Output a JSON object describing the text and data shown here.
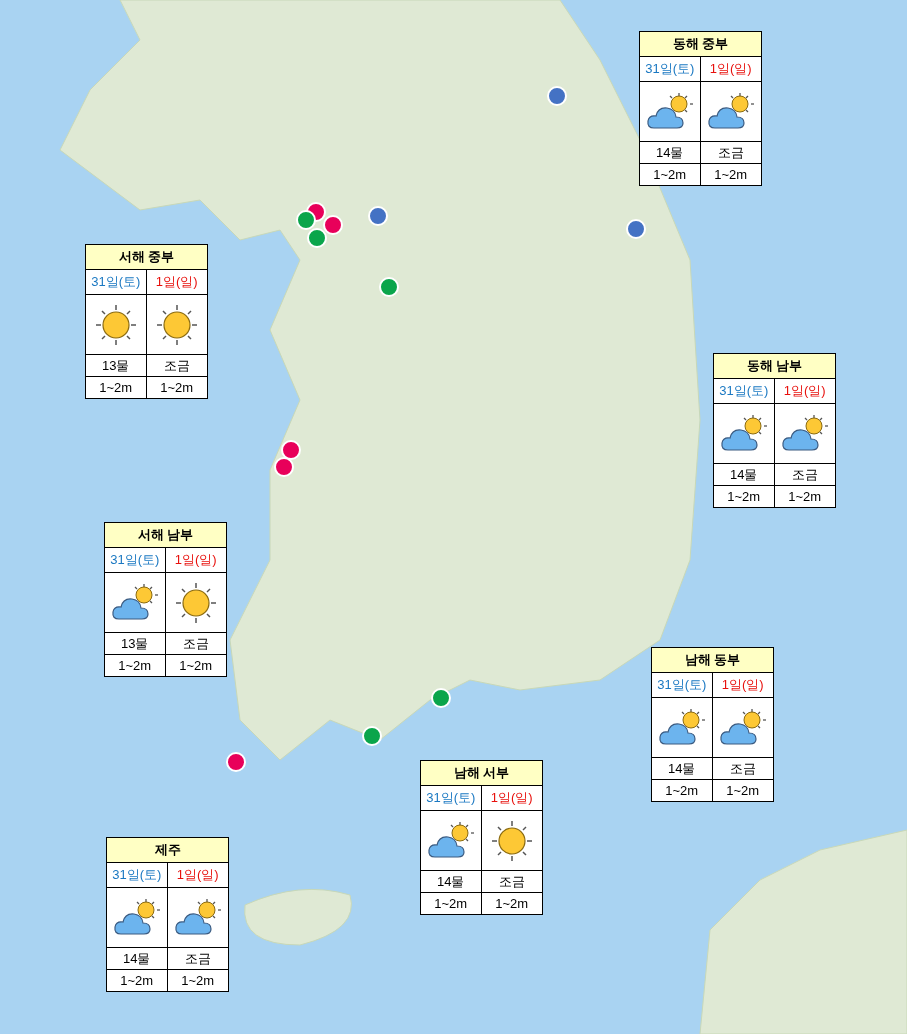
{
  "regions": [
    {
      "title": "동해 중부",
      "days": [
        {
          "label": "31일(토)",
          "color": "#1a78c2",
          "kind": "partly_cloudy",
          "tide": "14물",
          "wave": "1~2m"
        },
        {
          "label": "1일(일)",
          "color": "#e8100c",
          "kind": "partly_cloudy",
          "tide": "조금",
          "wave": "1~2m"
        }
      ]
    },
    {
      "title": "서해 중부",
      "days": [
        {
          "label": "31일(토)",
          "color": "#1a78c2",
          "kind": "sunny",
          "tide": "13물",
          "wave": "1~2m"
        },
        {
          "label": "1일(일)",
          "color": "#e8100c",
          "kind": "sunny",
          "tide": "조금",
          "wave": "1~2m"
        }
      ]
    },
    {
      "title": "동해 남부",
      "days": [
        {
          "label": "31일(토)",
          "color": "#1a78c2",
          "kind": "partly_cloudy",
          "tide": "14물",
          "wave": "1~2m"
        },
        {
          "label": "1일(일)",
          "color": "#e8100c",
          "kind": "partly_cloudy",
          "tide": "조금",
          "wave": "1~2m"
        }
      ]
    },
    {
      "title": "서해 남부",
      "days": [
        {
          "label": "31일(토)",
          "color": "#1a78c2",
          "kind": "partly_cloudy",
          "tide": "13물",
          "wave": "1~2m"
        },
        {
          "label": "1일(일)",
          "color": "#e8100c",
          "kind": "sunny",
          "tide": "조금",
          "wave": "1~2m"
        }
      ]
    },
    {
      "title": "남해 동부",
      "days": [
        {
          "label": "31일(토)",
          "color": "#1a78c2",
          "kind": "partly_cloudy",
          "tide": "14물",
          "wave": "1~2m"
        },
        {
          "label": "1일(일)",
          "color": "#e8100c",
          "kind": "partly_cloudy",
          "tide": "조금",
          "wave": "1~2m"
        }
      ]
    },
    {
      "title": "남해 서부",
      "days": [
        {
          "label": "31일(토)",
          "color": "#1a78c2",
          "kind": "partly_cloudy",
          "tide": "14물",
          "wave": "1~2m"
        },
        {
          "label": "1일(일)",
          "color": "#e8100c",
          "kind": "sunny",
          "tide": "조금",
          "wave": "1~2m"
        }
      ]
    },
    {
      "title": "제주",
      "days": [
        {
          "label": "31일(토)",
          "color": "#1a78c2",
          "kind": "partly_cloudy",
          "tide": "14물",
          "wave": "1~2m"
        },
        {
          "label": "1일(일)",
          "color": "#e8100c",
          "kind": "partly_cloudy",
          "tide": "조금",
          "wave": "1~2m"
        }
      ]
    }
  ],
  "markers": [
    {
      "color": "#4472c4"
    },
    {
      "color": "#4472c4"
    },
    {
      "color": "#4472c4"
    },
    {
      "color": "#e8005a"
    },
    {
      "color": "#e8005a"
    },
    {
      "color": "#e8005a"
    },
    {
      "color": "#e8005a"
    },
    {
      "color": "#e8005a"
    },
    {
      "color": "#0aa54b"
    },
    {
      "color": "#0aa54b"
    },
    {
      "color": "#0aa54b"
    },
    {
      "color": "#0aa54b"
    },
    {
      "color": "#0aa54b"
    }
  ]
}
